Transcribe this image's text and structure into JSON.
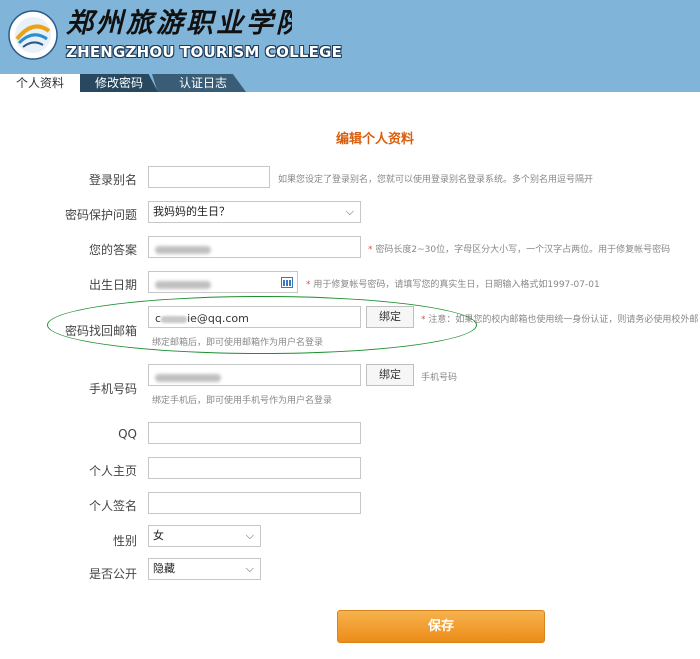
{
  "header": {
    "school_cn": "郑州旅游职业学院",
    "school_en": "ZHENGZHOU TOURISM COLLEGE",
    "logo_icon": "school-logo-icon"
  },
  "tabs": [
    {
      "label": "个人资料",
      "active": true
    },
    {
      "label": "修改密码",
      "active": false
    },
    {
      "label": "认证日志",
      "active": false
    }
  ],
  "form": {
    "title": "编辑个人资料",
    "alias": {
      "label": "登录别名",
      "value": "",
      "hint": "如果您设定了登录别名，您就可以使用登录别名登录系统。多个别名用逗号隔开"
    },
    "question": {
      "label": "密码保护问题",
      "value": "我妈妈的生日？"
    },
    "answer": {
      "label": "您的答案",
      "hint_star": "*",
      "hint": "密码长度2~30位，字母区分大小写，一个汉字占两位。用于修复帐号密码"
    },
    "birthday": {
      "label": "出生日期",
      "hint_star": "*",
      "hint": "用于修复帐号密码，请填写您的真实生日，日期输入格式如1997-07-01"
    },
    "email": {
      "label": "密码找回邮箱",
      "value_prefix": "c",
      "value_suffix": "ie@qq.com",
      "bind": "绑定",
      "hint_star": "*",
      "hint": "注意：如果您的校内邮箱也使用统一身份认证，则请务必使用校外邮",
      "subhint": "绑定邮箱后，即可使用邮箱作为用户名登录"
    },
    "phone": {
      "label": "手机号码",
      "bind": "绑定",
      "hint": "手机号码",
      "subhint": "绑定手机后，即可使用手机号作为用户名登录"
    },
    "qq": {
      "label": "QQ",
      "value": ""
    },
    "homepage": {
      "label": "个人主页",
      "value": ""
    },
    "signature": {
      "label": "个人签名",
      "value": ""
    },
    "gender": {
      "label": "性别",
      "value": "女"
    },
    "public": {
      "label": "是否公开",
      "value": "隐藏"
    },
    "save": "保存"
  },
  "colors": {
    "header_bg": "#80b4d8",
    "title_orange": "#d95f0e",
    "save_orange": "#ec8c18",
    "highlight_ellipse": "#1a8f2e"
  }
}
